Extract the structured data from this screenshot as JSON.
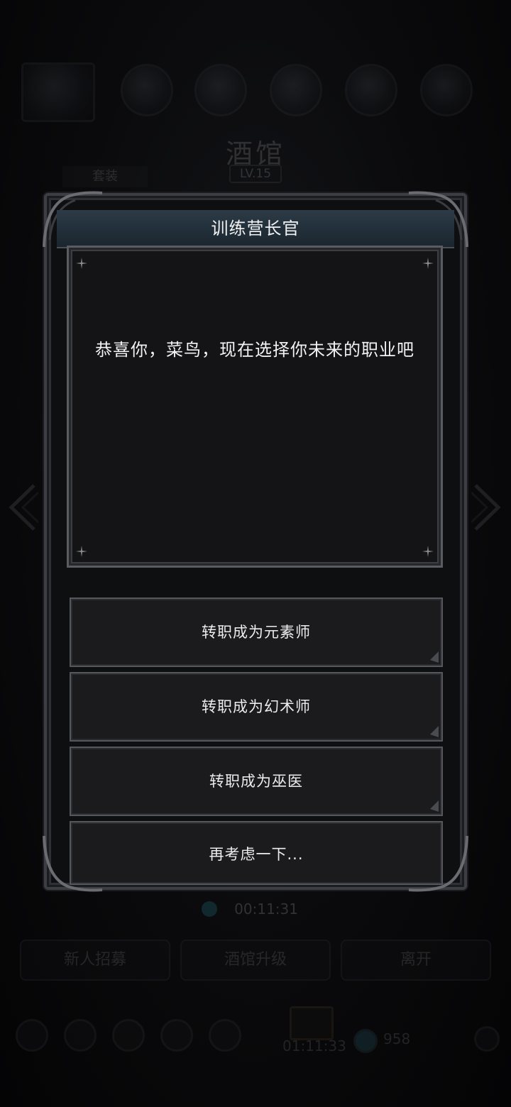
{
  "background": {
    "title": "酒馆",
    "level": "LV.15",
    "tag": "套装",
    "timer": "00:11:31",
    "buttons": [
      "新人招募",
      "酒馆升级",
      "离开"
    ],
    "bottom_timer": "01:11:33",
    "gem_count": "958"
  },
  "dialog": {
    "title": "训练营长官",
    "message": "恭喜你，菜鸟，现在选择你未来的职业吧",
    "options": [
      {
        "label": "转职成为元素师"
      },
      {
        "label": "转职成为幻术师"
      },
      {
        "label": "转职成为巫医"
      },
      {
        "label": "再考虑一下..."
      }
    ]
  },
  "colors": {
    "title_bar": "#22303b",
    "frame": "#3c3e44",
    "text": "#f2f2f2"
  }
}
